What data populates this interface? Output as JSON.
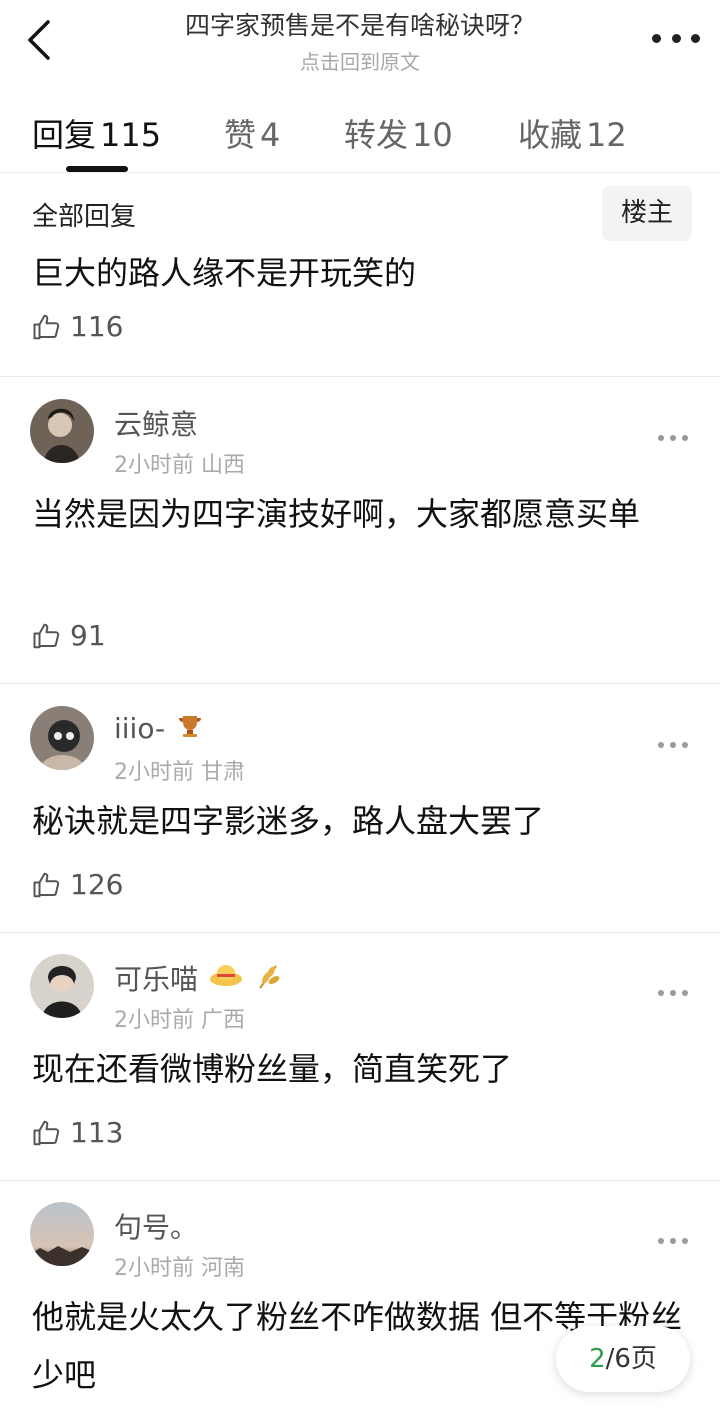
{
  "header": {
    "title": "四字家预售是不是有啥秘诀呀？",
    "subtitle": "点击回到原文"
  },
  "tabs": [
    {
      "label": "回复",
      "count": "115",
      "active": true
    },
    {
      "label": "赞",
      "count": "4",
      "active": false
    },
    {
      "label": "转发",
      "count": "10",
      "active": false
    },
    {
      "label": "收藏",
      "count": "12",
      "active": false
    }
  ],
  "op": {
    "section_label": "全部回复",
    "badge": "楼主",
    "text": "巨大的路人缘不是开玩笑的",
    "likes": "116"
  },
  "comments": [
    {
      "user": "云鲸意",
      "meta": "2小时前 山西",
      "text": "当然是因为四字演技好啊，大家都愿意买单",
      "likes": "91"
    },
    {
      "user": "iiio-",
      "meta": "2小时前 甘肃",
      "text": "秘诀就是四字影迷多，路人盘大罢了",
      "likes": "126"
    },
    {
      "user": "可乐喵",
      "meta": "2小时前 广西",
      "text": "现在还看微博粉丝量，简直笑死了",
      "likes": "113"
    },
    {
      "user": "句号。",
      "meta": "2小时前 河南",
      "text": "他就是火太久了粉丝不咋做数据 但不等于粉丝少吧",
      "likes": ""
    }
  ],
  "pager": {
    "current": "2",
    "total": "/6页"
  },
  "colors": {
    "accent_green": "#2e9e48"
  }
}
